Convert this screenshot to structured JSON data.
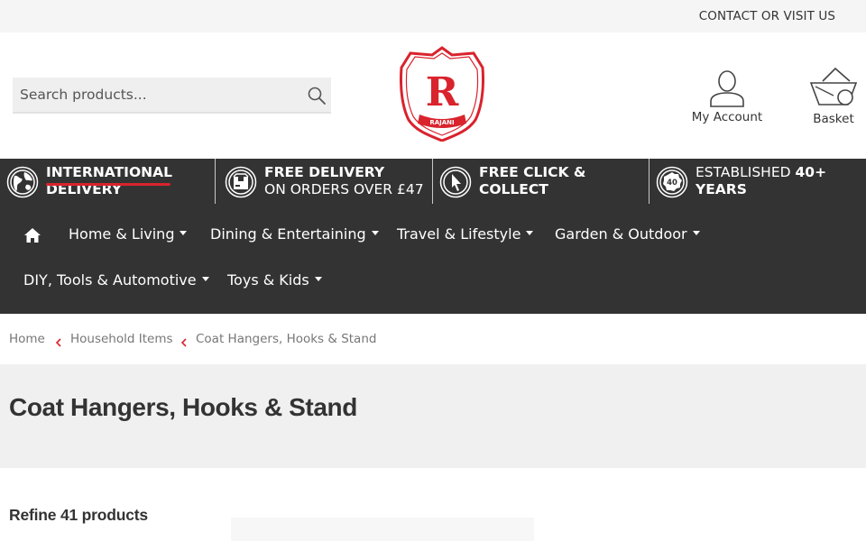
{
  "topbar": {
    "contact": "CONTACT OR VISIT US"
  },
  "header": {
    "search_placeholder": "Search products...",
    "logo_text": "RAJANI",
    "account_label": "My Account",
    "basket_label": "Basket",
    "brand_red": "#d9232d"
  },
  "benefits": [
    {
      "bold": "INTERNATIONAL DELIVERY",
      "line1": "INTERNATIONAL",
      "line2": "DELIVERY",
      "icon": "globe-icon"
    },
    {
      "line1": "FREE DELIVERY",
      "line2": "ON ORDERS OVER £47",
      "icon": "box-icon"
    },
    {
      "line1": "FREE CLICK &",
      "line2": "COLLECT",
      "icon": "cursor-icon"
    },
    {
      "line1_light": "ESTABLISHED ",
      "line1_bold": "40+",
      "line2": "YEARS",
      "icon": "badge-40-icon",
      "badge_text": "40"
    }
  ],
  "nav": {
    "items": [
      "Home & Living",
      "Dining & Entertaining",
      "Travel & Lifestyle",
      "Garden & Outdoor",
      "DIY, Tools & Automotive",
      "Toys & Kids"
    ]
  },
  "breadcrumb": [
    "Home",
    "Household Items",
    "Coat Hangers, Hooks & Stand"
  ],
  "page": {
    "title": "Coat Hangers, Hooks & Stand",
    "refine": "Refine 41 products"
  },
  "colors": {
    "dark_bar": "#333333",
    "accent": "#d9232d",
    "title_band": "#f0f0f0"
  }
}
